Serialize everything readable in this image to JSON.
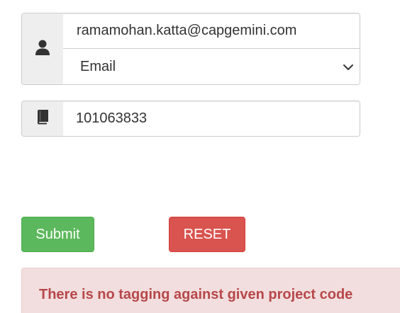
{
  "form": {
    "email_value": "ramamohan.katta@capgemini.com",
    "lookup_type_selected": "Email",
    "project_code_value": "101063833"
  },
  "icons": {
    "user_addon": "user-icon",
    "project_addon": "book-icon",
    "select_arrow": "chevron-down-icon"
  },
  "buttons": {
    "submit_label": "Submit",
    "reset_label": "RESET"
  },
  "alert": {
    "message": "There is no tagging against given project code"
  },
  "colors": {
    "submit_bg": "#5cb85c",
    "reset_bg": "#d9534f",
    "alert_bg": "#f2dede",
    "alert_text": "#b7474a",
    "addon_bg": "#eeeeee"
  }
}
